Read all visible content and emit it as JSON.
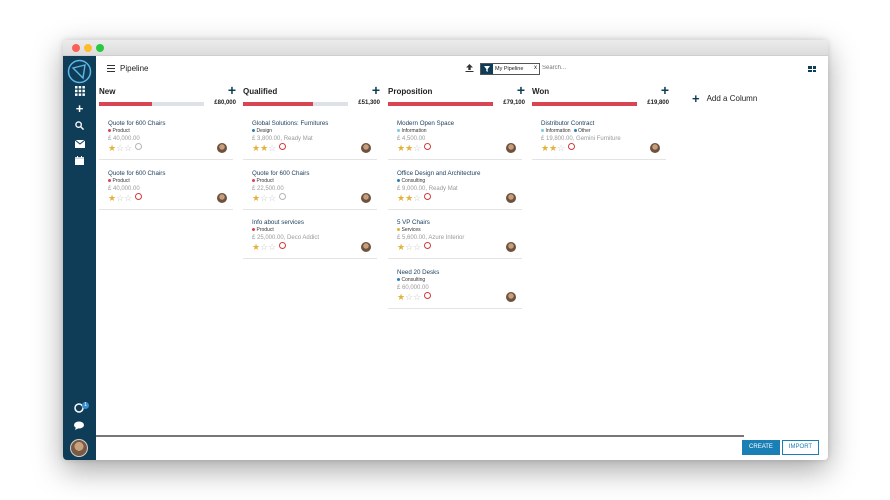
{
  "header": {
    "title": "Pipeline",
    "filter_label": "My Pipeline",
    "filter_clear": "x",
    "search_placeholder": "Search..."
  },
  "colors": {
    "sidebar": "#0f3d57",
    "accent": "#d64551",
    "primary": "#1a7fb5"
  },
  "columns": [
    {
      "title": "New",
      "total": "£80,000",
      "progress": 0.5,
      "cards": [
        {
          "title": "Quote for 600 Chairs",
          "tags": [
            {
              "label": "Product",
              "color": "#d64551"
            }
          ],
          "subtitle": "£ 40,000.00",
          "stars": 1,
          "activity": "none"
        },
        {
          "title": "Quote for 600 Chairs",
          "tags": [
            {
              "label": "Product",
              "color": "#d64551"
            }
          ],
          "subtitle": "£ 40,000.00",
          "stars": 1,
          "activity": "overdue"
        }
      ]
    },
    {
      "title": "Qualified",
      "total": "£51,300",
      "progress": 0.67,
      "cards": [
        {
          "title": "Global Solutions: Furnitures",
          "tags": [
            {
              "label": "Design",
              "color": "#2b7fb8"
            }
          ],
          "subtitle": "£ 3,800.00, Ready Mat",
          "stars": 2,
          "activity": "overdue"
        },
        {
          "title": "Quote for 600 Chairs",
          "tags": [
            {
              "label": "Product",
              "color": "#d64551"
            }
          ],
          "subtitle": "£ 22,500.00",
          "stars": 1,
          "activity": "none"
        },
        {
          "title": "Info about services",
          "tags": [
            {
              "label": "Product",
              "color": "#d64551"
            }
          ],
          "subtitle": "£ 25,000.00, Deco Addict",
          "stars": 1,
          "activity": "overdue"
        }
      ]
    },
    {
      "title": "Proposition",
      "total": "£79,100",
      "progress": 1.0,
      "cards": [
        {
          "title": "Modern Open Space",
          "tags": [
            {
              "label": "Information",
              "color": "#7fc6e8"
            }
          ],
          "subtitle": "£ 4,500.00",
          "stars": 2,
          "activity": "overdue"
        },
        {
          "title": "Office Design and Architecture",
          "tags": [
            {
              "label": "Consulting",
              "color": "#2b7fb8"
            }
          ],
          "subtitle": "£ 9,000.00, Ready Mat",
          "stars": 2,
          "activity": "overdue"
        },
        {
          "title": "5 VP Chairs",
          "tags": [
            {
              "label": "Services",
              "color": "#e2b23a"
            }
          ],
          "subtitle": "£ 5,600.00, Azure Interior",
          "stars": 1,
          "activity": "overdue"
        },
        {
          "title": "Need 20 Desks",
          "tags": [
            {
              "label": "Consulting",
              "color": "#2b7fb8"
            }
          ],
          "subtitle": "£ 60,000.00",
          "stars": 1,
          "activity": "overdue"
        }
      ]
    },
    {
      "title": "Won",
      "total": "£19,800",
      "progress": 1.0,
      "cards": [
        {
          "title": "Distributor Contract",
          "tags": [
            {
              "label": "Information",
              "color": "#7fc6e8"
            },
            {
              "label": "Other",
              "color": "#2b7fb8"
            }
          ],
          "subtitle": "£ 19,800.00, Gemini Furniture",
          "stars": 2,
          "activity": "overdue"
        }
      ]
    }
  ],
  "add_column_label": "Add a Column",
  "buttons": {
    "create": "CREATE",
    "import": "IMPORT"
  },
  "notification_count": "1"
}
